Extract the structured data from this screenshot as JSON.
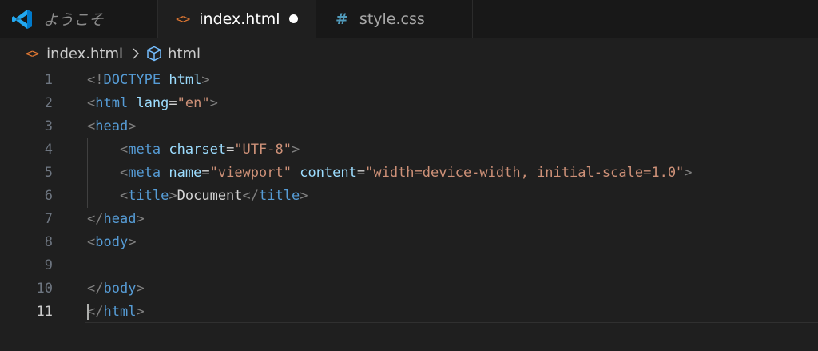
{
  "tabs": [
    {
      "label": "ようこそ",
      "icon": "vscode-logo-icon"
    },
    {
      "label": "index.html",
      "icon": "html-file-icon",
      "active": true,
      "modified": true
    },
    {
      "label": "style.css",
      "icon": "css-hash-icon"
    }
  ],
  "breadcrumb": {
    "file": "index.html",
    "element": "html"
  },
  "icons": {
    "html_glyph": "<>",
    "css_glyph": "#"
  },
  "colors": {
    "editor_background": "#1f1f1f",
    "tab_bar_background": "#181818",
    "tag": "#569cd6",
    "attribute": "#9cdcfe",
    "string": "#ce9178",
    "punctuation": "#808080",
    "html_icon": "#e37933",
    "css_icon": "#519aba"
  },
  "editor": {
    "active_line": 11,
    "lines": [
      {
        "number": "1",
        "text": "<!DOCTYPE html>"
      },
      {
        "number": "2",
        "text": "<html lang=\"en\">"
      },
      {
        "number": "3",
        "text": "<head>"
      },
      {
        "number": "4",
        "text": "    <meta charset=\"UTF-8\">"
      },
      {
        "number": "5",
        "text": "    <meta name=\"viewport\" content=\"width=device-width, initial-scale=1.0\">"
      },
      {
        "number": "6",
        "text": "    <title>Document</title>"
      },
      {
        "number": "7",
        "text": "</head>"
      },
      {
        "number": "8",
        "text": "<body>"
      },
      {
        "number": "9",
        "text": ""
      },
      {
        "number": "10",
        "text": "</body>"
      },
      {
        "number": "11",
        "text": "</html>"
      }
    ]
  }
}
